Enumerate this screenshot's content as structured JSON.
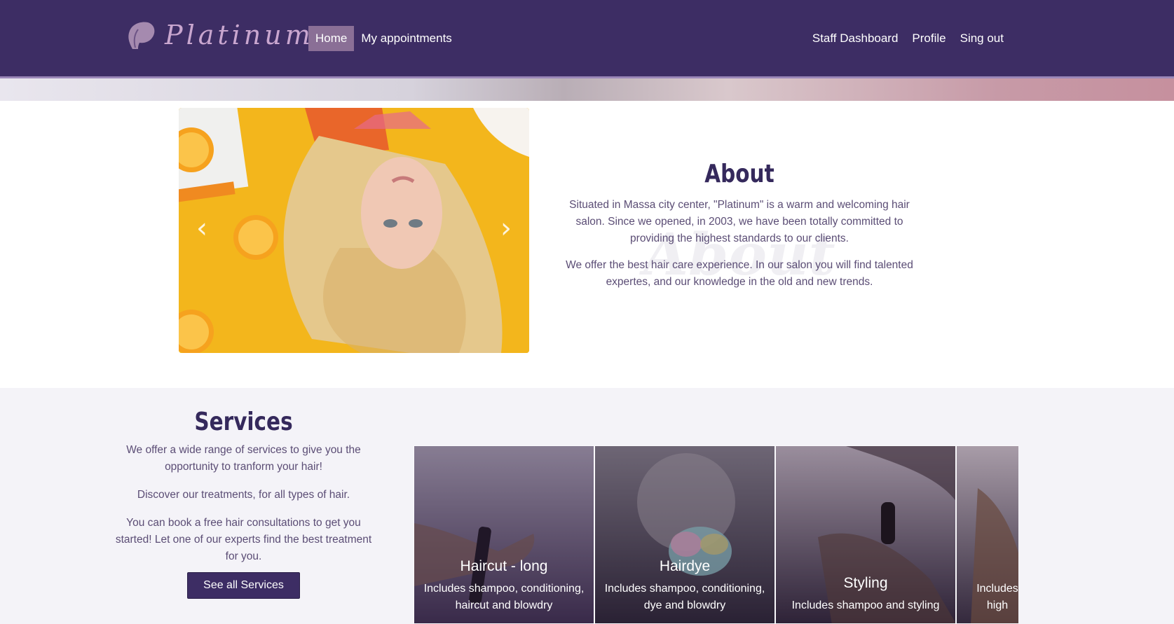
{
  "brand": {
    "name": "Platinum"
  },
  "nav": {
    "left": [
      {
        "label": "Home",
        "active": true
      },
      {
        "label": "My appointments",
        "active": false
      }
    ],
    "right": [
      {
        "label": "Staff Dashboard"
      },
      {
        "label": "Profile"
      },
      {
        "label": "Sing out"
      }
    ]
  },
  "about": {
    "watermark": "About",
    "title": "About",
    "paragraphs": [
      "Situated in Massa city center, \"Platinum\" is a warm and welcoming hair salon. Since we opened, in 2003, we have been totally committed to providing the highest standards to our clients.",
      "We offer the best hair care experience. In our salon you will find talented expertes, and our knowledge in the old and new trends."
    ],
    "carousel": {
      "prev_icon": "chevron-left-icon",
      "next_icon": "chevron-right-icon"
    }
  },
  "services": {
    "title": "Services",
    "paragraphs": [
      "We offer a wide range of services to give you the opportunity to tranform your hair!",
      "Discover our treatments, for all types of hair.",
      "You can book a free hair consultations to get you started! Let one of our experts find the best treatment for you."
    ],
    "button": "See all Services",
    "cards": [
      {
        "title": "Haircut - long",
        "desc1": "Includes shampoo, conditioning,",
        "desc2": "haircut and blowdry"
      },
      {
        "title": "Hairdye",
        "desc1": "Includes shampoo, conditioning,",
        "desc2": "dye and blowdry"
      },
      {
        "title": "Styling",
        "desc1": "Includes shampoo and styling",
        "desc2": ""
      },
      {
        "title": "",
        "desc1": "Includes",
        "desc2": "high"
      }
    ]
  },
  "colors": {
    "primary": "#3d2d64",
    "accent": "#8a6f96",
    "logo": "#c9a6cf",
    "background_alt": "#f4f3f8"
  }
}
